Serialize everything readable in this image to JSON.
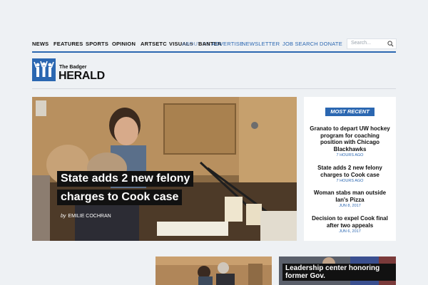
{
  "nav": {
    "items": [
      "NEWS",
      "FEATURES",
      "SPORTS",
      "OPINION",
      "ARTSETC",
      "VISUALS",
      "ABOUT US",
      "BANTER",
      "ADVERTISE",
      "NEWSLETTER",
      "JOB SEARCH",
      "DONATE"
    ],
    "search_placeholder": "Search..."
  },
  "logo": {
    "small": "The Badger",
    "big": "HERALD"
  },
  "hero": {
    "title_lines": [
      "State adds 2 new felony",
      "charges to Cook case"
    ],
    "byline_prefix": "by",
    "author": "EMILIE COCHRAN"
  },
  "sidebar": {
    "badge": "MOST RECENT",
    "items": [
      {
        "title": "Granato to depart UW hockey program for coaching position with Chicago Blackhawks",
        "date": "7 HOURS AGO"
      },
      {
        "title": "State adds 2 new felony charges to Cook case",
        "date": "7 HOURS AGO"
      },
      {
        "title": "Woman stabs man outside Ian's Pizza",
        "date": "JUN 8, 2017"
      },
      {
        "title": "Decision to expel Cook final after two appeals",
        "date": "JUN 6, 2017"
      }
    ]
  },
  "cards": [
    {
      "label": ""
    },
    {
      "label": "Leadership center honoring former Gov."
    }
  ],
  "colors": {
    "brand": "#2b67b1",
    "background": "#eef1f4"
  }
}
